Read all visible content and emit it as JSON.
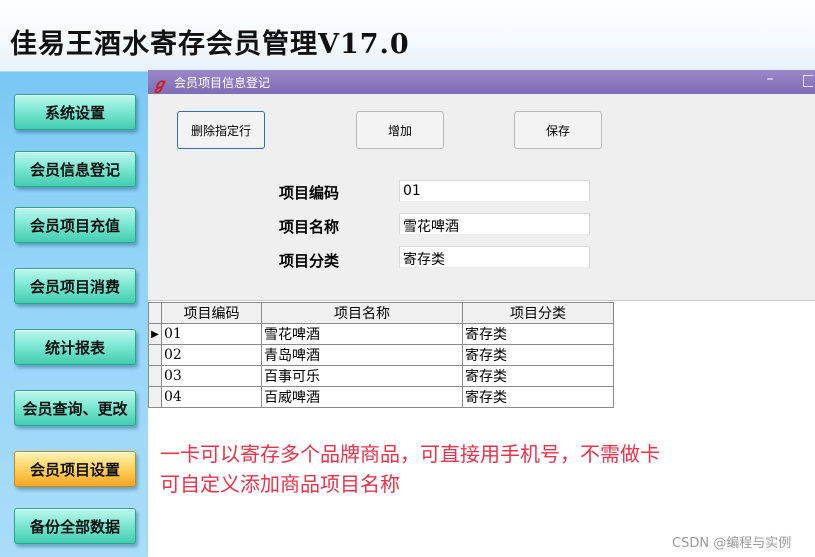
{
  "app": {
    "title": "佳易王酒水寄存会员管理V17.0"
  },
  "sidebar": {
    "items": [
      {
        "label": "系统设置",
        "active": false
      },
      {
        "label": "会员信息登记",
        "active": false
      },
      {
        "label": "会员项目充值",
        "active": false
      },
      {
        "label": "会员项目消费",
        "active": false
      },
      {
        "label": "统计报表",
        "active": false
      },
      {
        "label": "会员查询、更改",
        "active": false
      },
      {
        "label": "会员项目设置",
        "active": true
      },
      {
        "label": "备份全部数据",
        "active": false
      }
    ]
  },
  "dialog": {
    "title": "会员项目信息登记",
    "buttons": {
      "delete": "删除指定行",
      "add": "增加",
      "save": "保存"
    },
    "fields": {
      "code": {
        "label": "项目编码",
        "value": "01"
      },
      "name": {
        "label": "项目名称",
        "value": "雪花啤酒"
      },
      "category": {
        "label": "项目分类",
        "value": "寄存类"
      }
    },
    "grid": {
      "headers": [
        "项目编码",
        "项目名称",
        "项目分类"
      ],
      "rows": [
        {
          "code": "01",
          "name": "雪花啤酒",
          "category": "寄存类",
          "current": true
        },
        {
          "code": "02",
          "name": "青岛啤酒",
          "category": "寄存类",
          "current": false
        },
        {
          "code": "03",
          "name": "百事可乐",
          "category": "寄存类",
          "current": false
        },
        {
          "code": "04",
          "name": "百威啤酒",
          "category": "寄存类",
          "current": false
        }
      ]
    },
    "notes": [
      "一卡可以寄存多个品牌商品，可直接用手机号，不需做卡",
      "可自定义添加商品项目名称"
    ],
    "watermark": "CSDN @编程与实例"
  },
  "icons": {
    "title_logo": "jiayi-logo-icon",
    "row_pointer": "row-pointer-icon"
  },
  "colors": {
    "note_text": "#e8334a",
    "titlebar": "#8a78be",
    "active_button": "#f5a623",
    "sidebar_button": "#42cdb0"
  }
}
